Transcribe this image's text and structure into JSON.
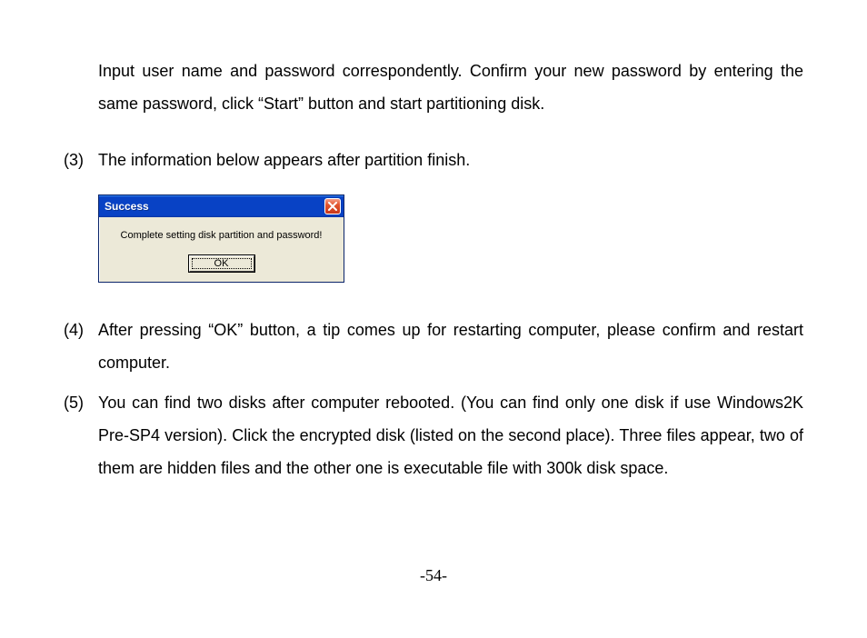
{
  "para_cont": "Input user name and password correspondently. Confirm your new password by entering the same password, click “Start” button and start partitioning disk.",
  "items": {
    "m3": "(3)",
    "t3": "The information below appears after partition finish.",
    "m4": "(4)",
    "t4": "After pressing “OK” button, a tip comes up for restarting computer, please confirm and restart computer.",
    "m5": "(5)",
    "t5": "You can find two disks after computer rebooted. (You can find only one disk if use Windows2K Pre-SP4 version). Click the encrypted disk (listed on the second place). Three files appear, two of them are hidden files and the other one is executable file with 300k disk space."
  },
  "dialog": {
    "title": "Success",
    "message": "Complete setting disk partition and password!",
    "ok": "OK"
  },
  "page_number": "-54-"
}
